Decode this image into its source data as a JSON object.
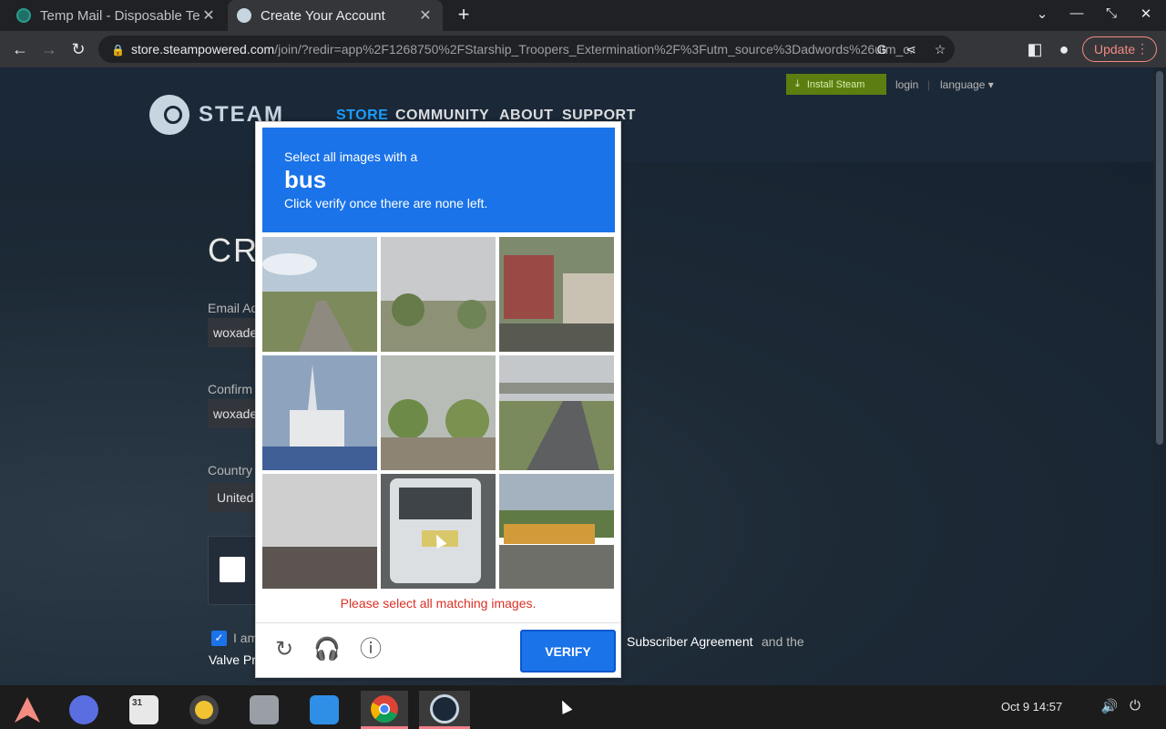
{
  "browser": {
    "tabs": [
      {
        "title": "Temp Mail - Disposable Te",
        "favicon_color": "#2a9d8f"
      },
      {
        "title": "Create Your Account",
        "favicon_color": "#1b2838"
      }
    ],
    "new_tab": "+",
    "window_controls": {
      "collapse": "⌄",
      "minimize": "—",
      "restore": "⤡",
      "close": "✕"
    },
    "url_host": "store.steampowered.com",
    "url_path": "/join/?redir=app%2F1268750%2FStarship_Troopers_Extermination%2F%3Futm_source%3Dadwords%26utm_c...",
    "update_label": "Update"
  },
  "steam": {
    "install_label": "Install Steam",
    "login_label": "login",
    "separator": "|",
    "language_label": "language",
    "logo_text": "STEAM",
    "nav": [
      "STORE",
      "COMMUNITY",
      "ABOUT",
      "SUPPORT"
    ],
    "accent": "#1a9fff",
    "form": {
      "title": "CRE",
      "email_label": "Email Ad",
      "email_value": "woxade",
      "confirm_label": "Confirm",
      "confirm_value": "woxade",
      "country_label": "Country",
      "country_value": "United",
      "agree_prefix": "I am",
      "ssa_link": "Subscriber Agreement",
      "and_the": "and the",
      "valve_link": "Valve Pr"
    }
  },
  "captcha": {
    "instruction": "Select all images with a",
    "target": "bus",
    "hint": "Click verify once there are none left.",
    "error": "Please select all matching images.",
    "verify_label": "VERIFY",
    "icons": [
      "reload-icon",
      "audio-icon",
      "info-icon"
    ],
    "tiles": [
      {
        "scene": "road-sky"
      },
      {
        "scene": "trees-fog"
      },
      {
        "scene": "truck-house"
      },
      {
        "scene": "church"
      },
      {
        "scene": "street-trees"
      },
      {
        "scene": "highway-overpass"
      },
      {
        "scene": "fog-building"
      },
      {
        "scene": "bus-rear"
      },
      {
        "scene": "yellow-bus"
      }
    ],
    "accent": "#1a73e8"
  },
  "taskbar": {
    "apps": [
      "arch-launcher",
      "compass-browser",
      "calendar",
      "music-player",
      "files",
      "store",
      "chrome",
      "steam"
    ],
    "calendar_day": "31",
    "clock": "Oct 9  14:57",
    "active": [
      "chrome",
      "steam"
    ]
  }
}
